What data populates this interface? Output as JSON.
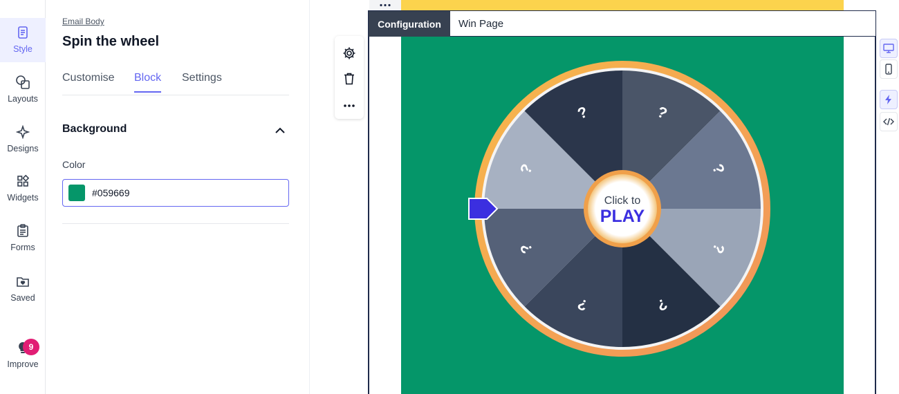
{
  "rail": {
    "items": [
      {
        "label": "Style",
        "icon": "style-icon"
      },
      {
        "label": "Layouts",
        "icon": "layouts-icon"
      },
      {
        "label": "Designs",
        "icon": "designs-icon"
      },
      {
        "label": "Widgets",
        "icon": "widgets-icon"
      },
      {
        "label": "Forms",
        "icon": "forms-icon"
      },
      {
        "label": "Saved",
        "icon": "saved-icon"
      },
      {
        "label": "Improve",
        "icon": "lightbulb-icon",
        "badge": "9"
      }
    ]
  },
  "panel": {
    "breadcrumb": "Email Body",
    "title": "Spin the wheel",
    "tabs": [
      "Customise",
      "Block",
      "Settings"
    ],
    "active_tab": "Block",
    "section_title": "Background",
    "color_label": "Color",
    "color_value": "#059669"
  },
  "editor": {
    "tabs": [
      "Configuration",
      "Win Page"
    ],
    "active_tab": "Configuration",
    "accent_color": "#6366f1",
    "background_color": "#059669",
    "top_strip_color": "#fcd34d"
  },
  "wheel": {
    "segments": [
      "?",
      "?",
      "?",
      "?",
      "?",
      "?",
      "?",
      "?"
    ],
    "center_line1": "Click to",
    "center_line2": "PLAY",
    "rim_color": "#f6a94a",
    "pointer_color": "#3b2fe0"
  }
}
